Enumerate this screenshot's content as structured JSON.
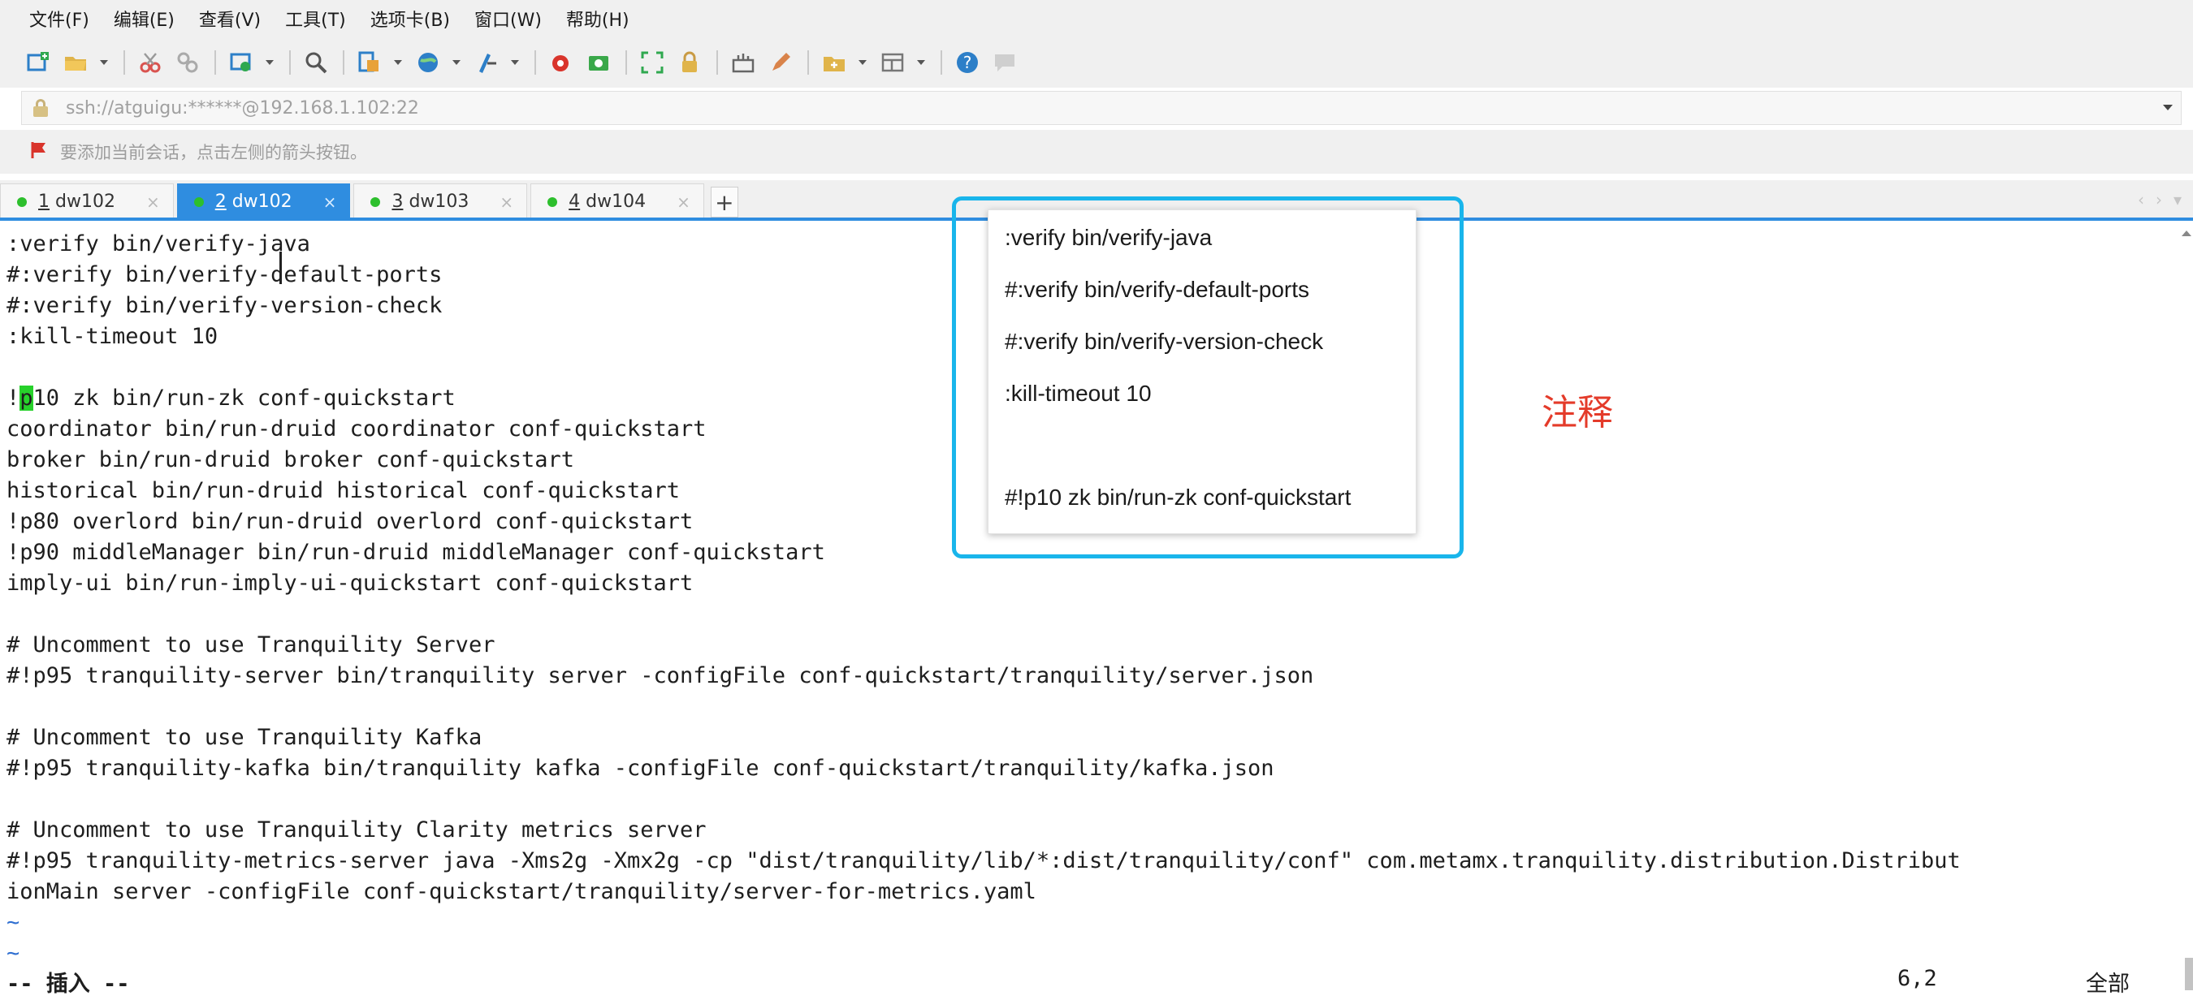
{
  "menubar": {
    "items": [
      "文件(F)",
      "编辑(E)",
      "查看(V)",
      "工具(T)",
      "选项卡(B)",
      "窗口(W)",
      "帮助(H)"
    ]
  },
  "toolbar": {
    "icons": [
      "new-session-icon",
      "open-folder-icon",
      "cut-icon",
      "link-icon",
      "reconnect-icon",
      "search-icon",
      "properties-icon",
      "globe-icon",
      "script-icon",
      "record-icon",
      "camera-icon",
      "fullscreen-icon",
      "lock-icon",
      "keyboard-icon",
      "pen-icon",
      "folder-icon",
      "layout-icon",
      "help-icon",
      "chat-icon"
    ]
  },
  "address": {
    "text": "ssh://atguigu:******@192.168.1.102:22"
  },
  "hint": {
    "text": "要添加当前会话，点击左侧的箭头按钮。"
  },
  "tabs": [
    {
      "number": "1",
      "name": "dw102",
      "active": false
    },
    {
      "number": "2",
      "name": "dw102",
      "active": true
    },
    {
      "number": "3",
      "name": "dw103",
      "active": false
    },
    {
      "number": "4",
      "name": "dw104",
      "active": false
    }
  ],
  "terminal": {
    "lines": [
      ":verify bin/verify-java",
      "#:verify bin/verify-default-ports",
      "#:verify bin/verify-version-check",
      ":kill-timeout 10",
      "",
      "!p10 zk bin/run-zk conf-quickstart",
      "coordinator bin/run-druid coordinator conf-quickstart",
      "broker bin/run-druid broker conf-quickstart",
      "historical bin/run-druid historical conf-quickstart",
      "!p80 overlord bin/run-druid overlord conf-quickstart",
      "!p90 middleManager bin/run-druid middleManager conf-quickstart",
      "imply-ui bin/run-imply-ui-quickstart conf-quickstart",
      "",
      "# Uncomment to use Tranquility Server",
      "#!p95 tranquility-server bin/tranquility server -configFile conf-quickstart/tranquility/server.json",
      "",
      "# Uncomment to use Tranquility Kafka",
      "#!p95 tranquility-kafka bin/tranquility kafka -configFile conf-quickstart/tranquility/kafka.json",
      "",
      "# Uncomment to use Tranquility Clarity metrics server",
      "#!p95 tranquility-metrics-server java -Xms2g -Xmx2g -cp \"dist/tranquility/lib/*:dist/tranquility/conf\" com.metamx.tranquility.distribution.Distribut",
      "ionMain server -configFile conf-quickstart/tranquility/server-for-metrics.yaml",
      "~",
      "~"
    ],
    "cursor_line_index": 5,
    "cursor_prefix": "!",
    "cursor_char": "p",
    "cursor_suffix": "10 zk bin/run-zk conf-quickstart"
  },
  "status": {
    "mode": "-- 插入 --",
    "position": "6,2",
    "scope": "全部"
  },
  "callout": {
    "lines": [
      ":verify bin/verify-java",
      "#:verify bin/verify-default-ports",
      "#:verify bin/verify-version-check",
      ":kill-timeout 10",
      "",
      "#!p10 zk bin/run-zk conf-quickstart"
    ],
    "label": "注释",
    "border_color": "#19b5eb",
    "label_color": "#e43b2a"
  },
  "colors": {
    "accent": "#2f8de0",
    "cursor": "#27d12b",
    "tab_dot": "#2dbf2d"
  }
}
